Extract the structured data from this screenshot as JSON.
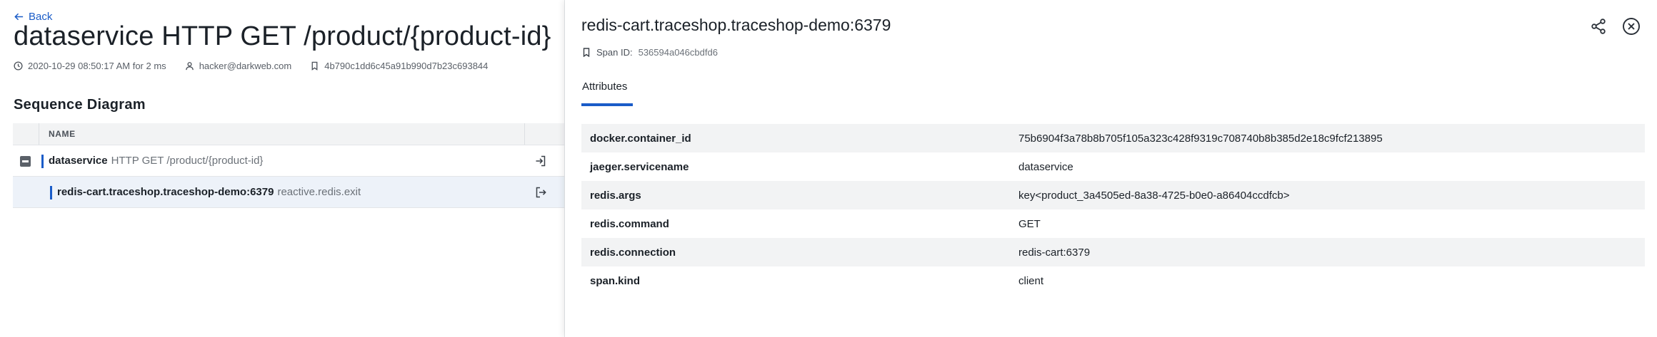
{
  "trace": {
    "back_label": "Back",
    "title": "dataservice HTTP GET /product/{product-id}",
    "timestamp": "2020-10-29 08:50:17 AM for 2 ms",
    "user": "hacker@darkweb.com",
    "trace_id": "4b790c1dd6c45a91b990d7b23c693844"
  },
  "sequence": {
    "title": "Sequence Diagram",
    "column_name": "NAME",
    "rows": [
      {
        "service": "dataservice",
        "operation": "HTTP GET /product/{product-id}"
      },
      {
        "service": "redis-cart.traceshop.traceshop-demo:6379",
        "operation": "reactive.redis.exit"
      }
    ]
  },
  "span": {
    "title": "redis-cart.traceshop.traceshop-demo:6379",
    "span_id_label": "Span ID:",
    "span_id": "536594a046cbdfd6",
    "tab_attributes": "Attributes",
    "attributes": [
      {
        "key": "docker.container_id",
        "value": "75b6904f3a78b8b705f105a323c428f9319c708740b8b385d2e18c9fcf213895"
      },
      {
        "key": "jaeger.servicename",
        "value": "dataservice"
      },
      {
        "key": "redis.args",
        "value": "key<product_3a4505ed-8a38-4725-b0e0-a86404ccdfcb>"
      },
      {
        "key": "redis.command",
        "value": "GET"
      },
      {
        "key": "redis.connection",
        "value": "redis-cart:6379"
      },
      {
        "key": "span.kind",
        "value": "client"
      }
    ]
  },
  "colors": {
    "accent": "#1a5cc8",
    "selected_row": "#edf2f9",
    "zebra": "#f2f3f4"
  },
  "icons": [
    "arrow-left-icon",
    "clock-icon",
    "user-icon",
    "bookmark-icon",
    "minus-square-icon",
    "log-in-icon",
    "log-out-icon",
    "share-icon",
    "close-circle-icon"
  ]
}
